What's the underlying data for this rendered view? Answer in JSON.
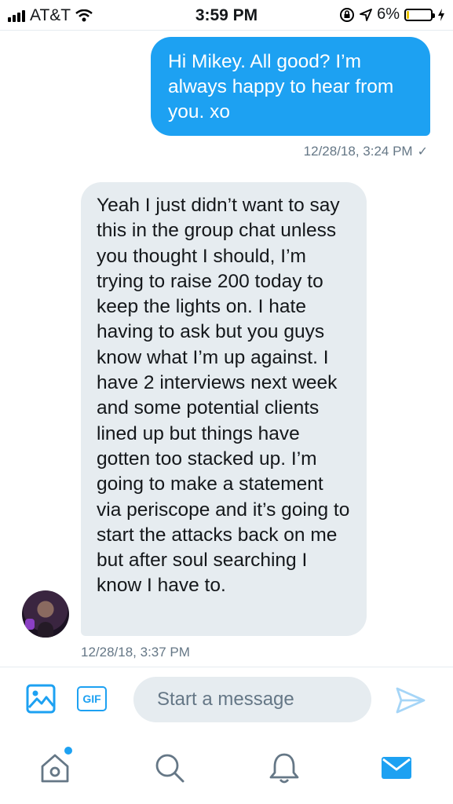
{
  "status_bar": {
    "carrier": "AT&T",
    "time": "3:59 PM",
    "battery": "6%"
  },
  "messages": [
    {
      "direction": "outgoing",
      "text": "Hi Mikey. All good?  I’m always happy to hear from you. xo",
      "timestamp": "12/28/18, 3:24 PM",
      "read_mark": "✓"
    },
    {
      "direction": "incoming",
      "text": "Yeah I just didn’t want to say this in the group chat unless you thought I should, I’m trying to raise 200 today to keep the lights on. I hate having to ask but you guys know what I’m up against. I have 2 interviews next week and some potential clients lined up but things have gotten too stacked up. I’m going to make a statement via periscope and it’s going to start the attacks back on me but after soul searching I know I have to.",
      "timestamp": "12/28/18, 3:37 PM"
    }
  ],
  "composer": {
    "gif_label": "GIF",
    "placeholder": "Start a message"
  },
  "icons": [
    "signal-icon",
    "wifi-icon",
    "orientation-lock-icon",
    "location-icon",
    "battery-icon",
    "charging-icon",
    "image-icon",
    "gif-icon",
    "send-icon",
    "home-icon",
    "search-icon",
    "notifications-icon",
    "messages-icon"
  ],
  "colors": {
    "accent": "#1da1f2",
    "bubble_incoming": "#e6ecf0",
    "secondary_text": "#657786",
    "battery_low": "#e8c400"
  }
}
